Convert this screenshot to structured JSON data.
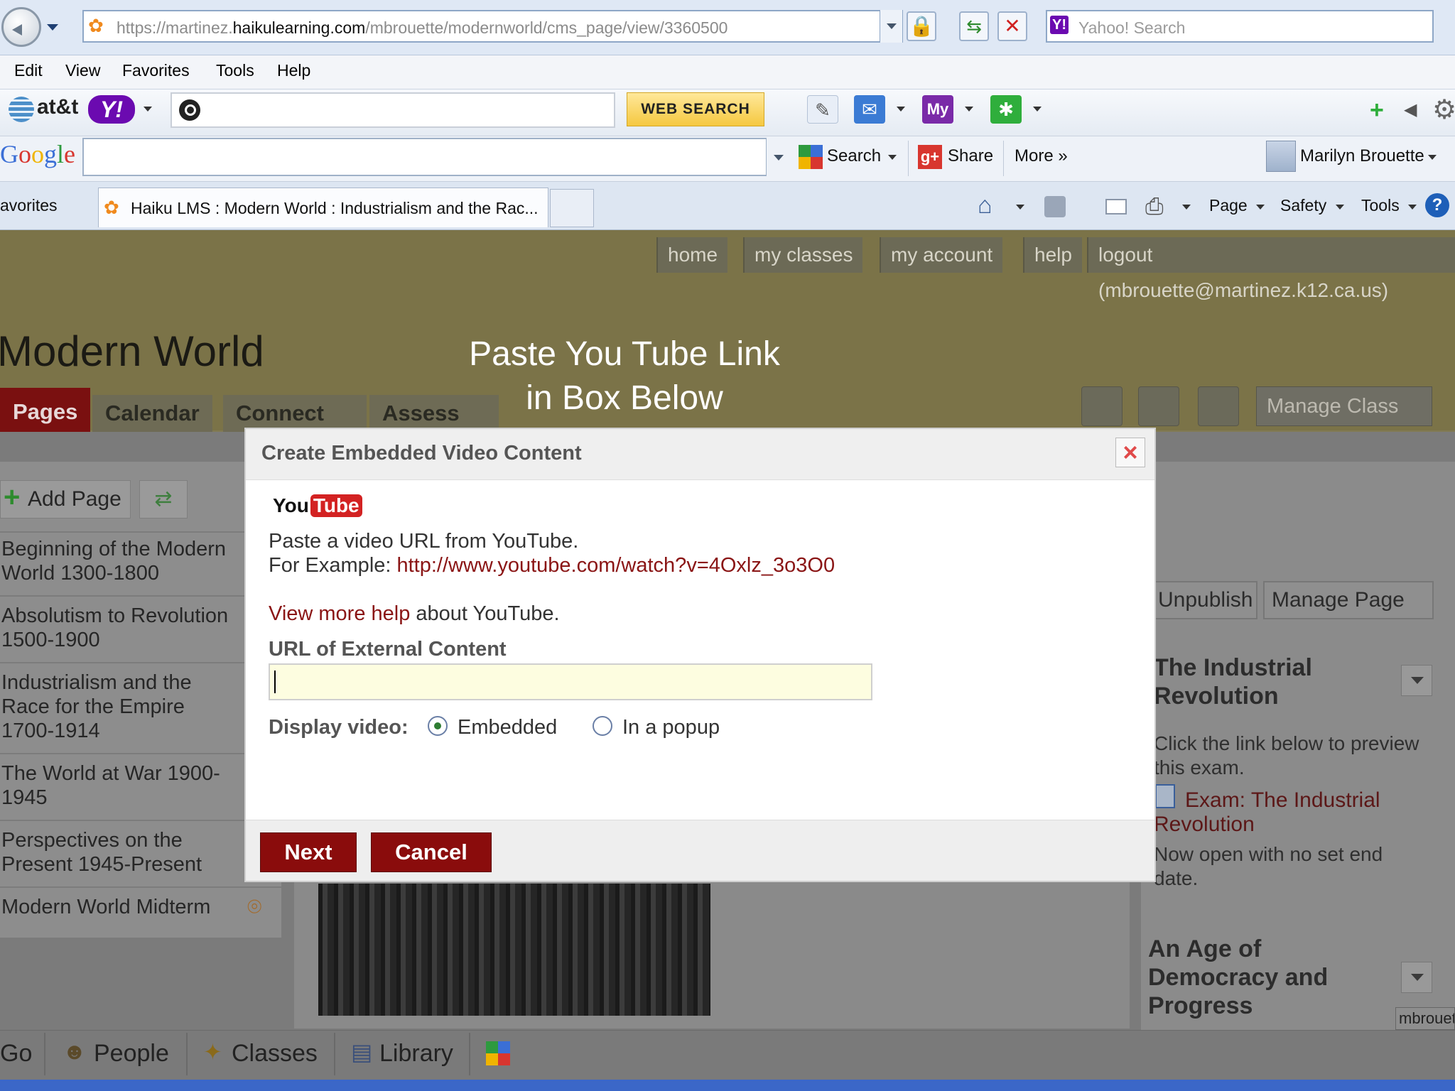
{
  "browser": {
    "url_prefix": "https://",
    "url_host_start": "martinez.",
    "url_host_main": "haikulearning.com",
    "url_path": "/mbrouette/modernworld/cms_page/view/3360500",
    "search_placeholder": "Yahoo! Search",
    "yahoo_badge": "Y!",
    "menu": [
      "Edit",
      "View",
      "Favorites",
      "Tools",
      "Help"
    ],
    "att_logo": "at&t",
    "y_logo": "Y!",
    "web_search": "WEB SEARCH",
    "my_icon": "My",
    "google_logo": "Google",
    "google_search": "Search",
    "google_share": "Share",
    "google_more": "More »",
    "google_user": "Marilyn Brouette",
    "favorites_label": "avorites",
    "tab_title": "Haiku LMS : Modern World : Industrialism and the Rac...",
    "cmd_page": "Page",
    "cmd_safety": "Safety",
    "cmd_tools": "Tools",
    "help_glyph": "?"
  },
  "haiku": {
    "topnav": [
      "home",
      "my classes",
      "my account",
      "help",
      "logout (mbrouette@martinez.k12.ca.us)"
    ],
    "site_title": "Modern World",
    "overlay_caption_line1": "Paste You Tube Link",
    "overlay_caption_line2": "in Box Below",
    "class_tabs": [
      "Pages",
      "Calendar",
      "Connect",
      "Assess"
    ],
    "manage_class": "Manage Class",
    "add_page": "Add Page",
    "sidebar_pages": [
      "Beginning of the Modern World 1300-1800",
      "Absolutism to Revolution 1500-1900",
      "Industrialism and the Race for the Empire 1700-1914",
      "The World at War 1900-1945",
      "Perspectives on the Present 1945-Present",
      "Modern World Midterm"
    ],
    "unpublish": "Unpublish",
    "manage_page": "Manage Page",
    "panel1_title": "The Industrial Revolution",
    "panel1_text": "Click the link below to preview this exam.",
    "panel1_link": "Exam: The Industrial Revolution",
    "panel1_status": "Now open with no set end date.",
    "panel2_title": "An Age of Democracy and Progress",
    "user_tag": "mbrouet",
    "bottom_nav": [
      "Go",
      "People",
      "Classes",
      "Library"
    ]
  },
  "dialog": {
    "title": "Create Embedded Video Content",
    "close_glyph": "×",
    "yt_you": "You",
    "yt_tube": "Tube",
    "intro": "Paste a video URL from YouTube.",
    "example_prefix": "For Example: ",
    "example_url": "http://www.youtube.com/watch?v=4Oxlz_3o3O0",
    "help_link": "View more help",
    "help_suffix": " about YouTube.",
    "url_label": "URL of External Content",
    "url_value": "",
    "display_label": "Display video:",
    "option_embedded": "Embedded",
    "option_popup": "In a popup",
    "selected_option": "Embedded",
    "next": "Next",
    "cancel": "Cancel"
  },
  "colors": {
    "header_olive": "#7b7348",
    "active_tab": "#9a1414",
    "dialog_button": "#8a0c0c",
    "link_red": "#8a1515"
  }
}
